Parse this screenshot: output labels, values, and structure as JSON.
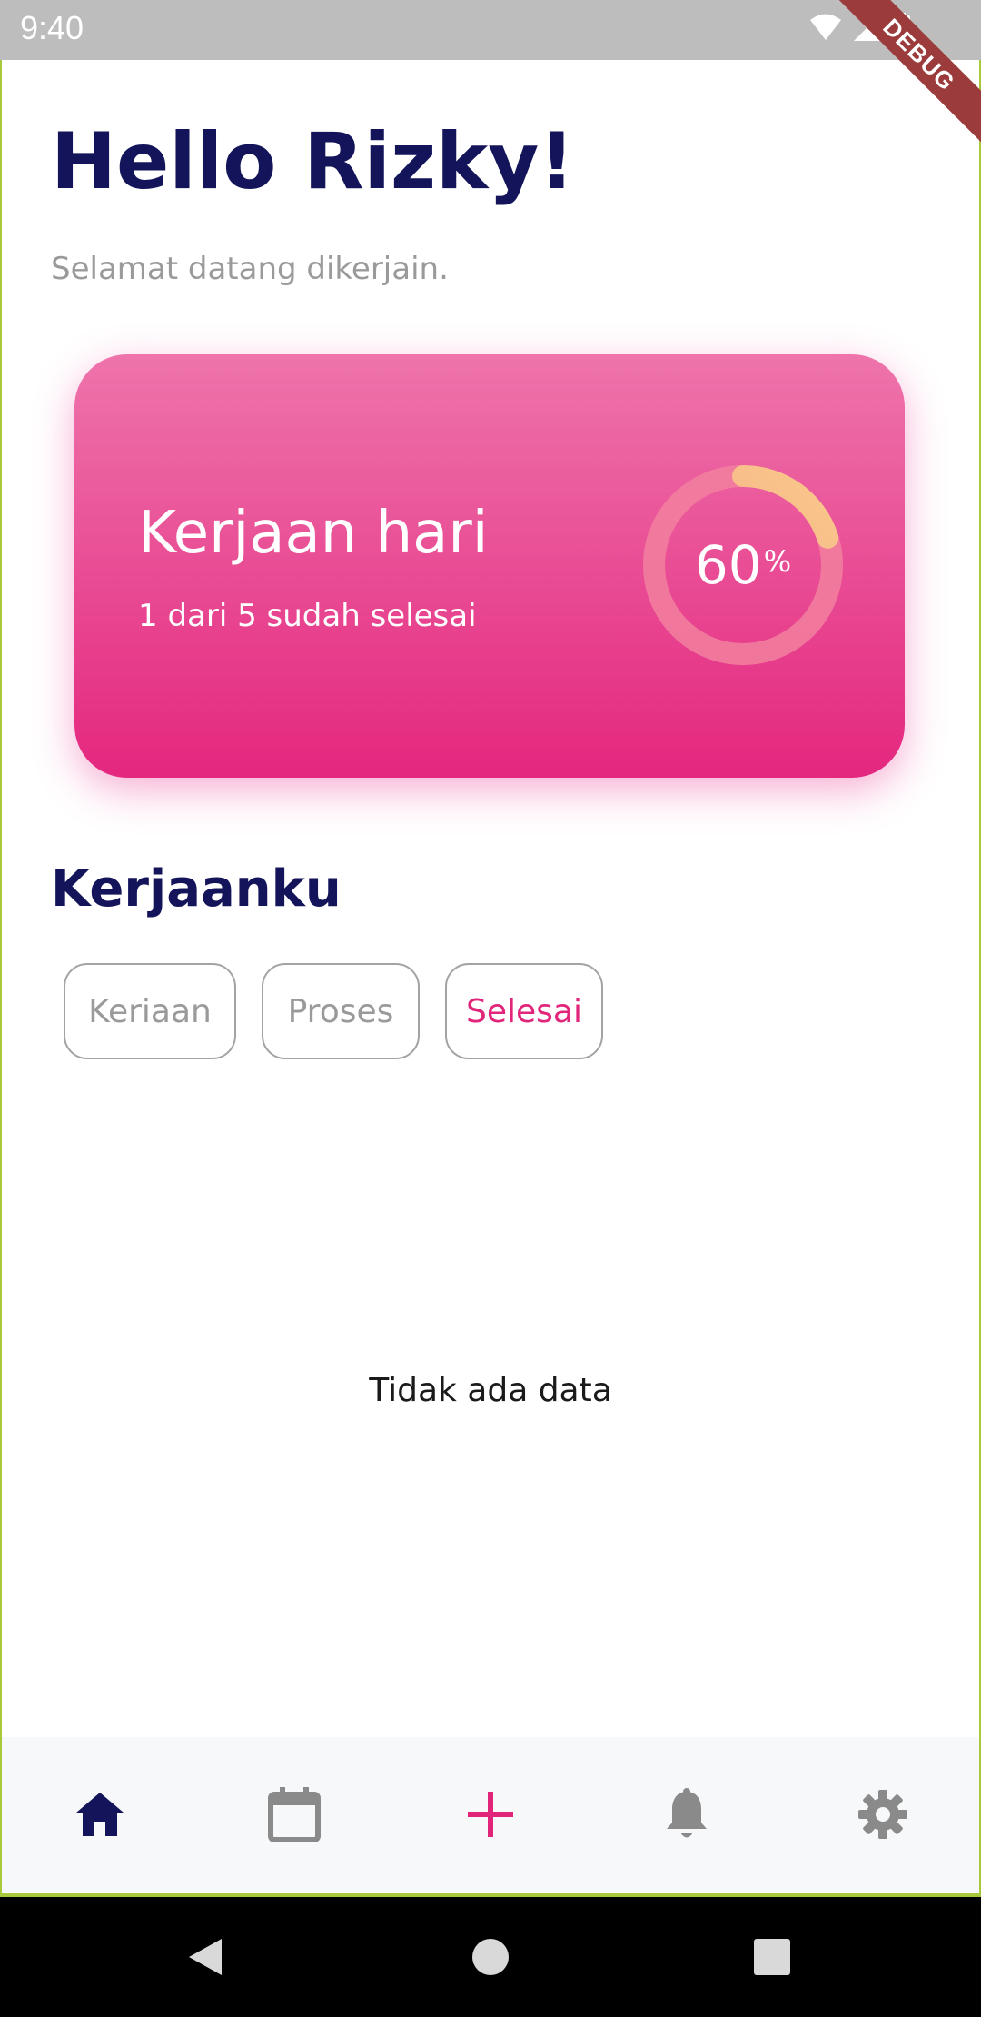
{
  "status_bar": {
    "time": "9:40",
    "debug_label": "DEBUG"
  },
  "greeting": {
    "title": "Hello Rizky!",
    "subtitle": "Selamat datang dikerjain."
  },
  "summary_card": {
    "title": "Kerjaan hari",
    "subtitle": "1 dari 5 sudah selesai",
    "progress_number": "60",
    "progress_unit": "%",
    "progress_fraction": 0.2,
    "gradient_top": "#ee74ab",
    "gradient_bottom": "#e4277f"
  },
  "section": {
    "title": "Kerjaanku"
  },
  "filter_chips": [
    {
      "label": "Keriaan",
      "active": false
    },
    {
      "label": "Proses",
      "active": false
    },
    {
      "label": "Selesai",
      "active": true
    }
  ],
  "empty_state": {
    "text": "Tidak ada data"
  },
  "bottom_nav": [
    {
      "icon": "home-icon",
      "active": true
    },
    {
      "icon": "calendar-icon",
      "active": false
    },
    {
      "icon": "add-icon",
      "active": false
    },
    {
      "icon": "bell-icon",
      "active": false
    },
    {
      "icon": "gear-icon",
      "active": false
    }
  ],
  "colors": {
    "primary_text": "#14145a",
    "accent_pink": "#e0257b",
    "muted_text": "#9a9a9a"
  }
}
